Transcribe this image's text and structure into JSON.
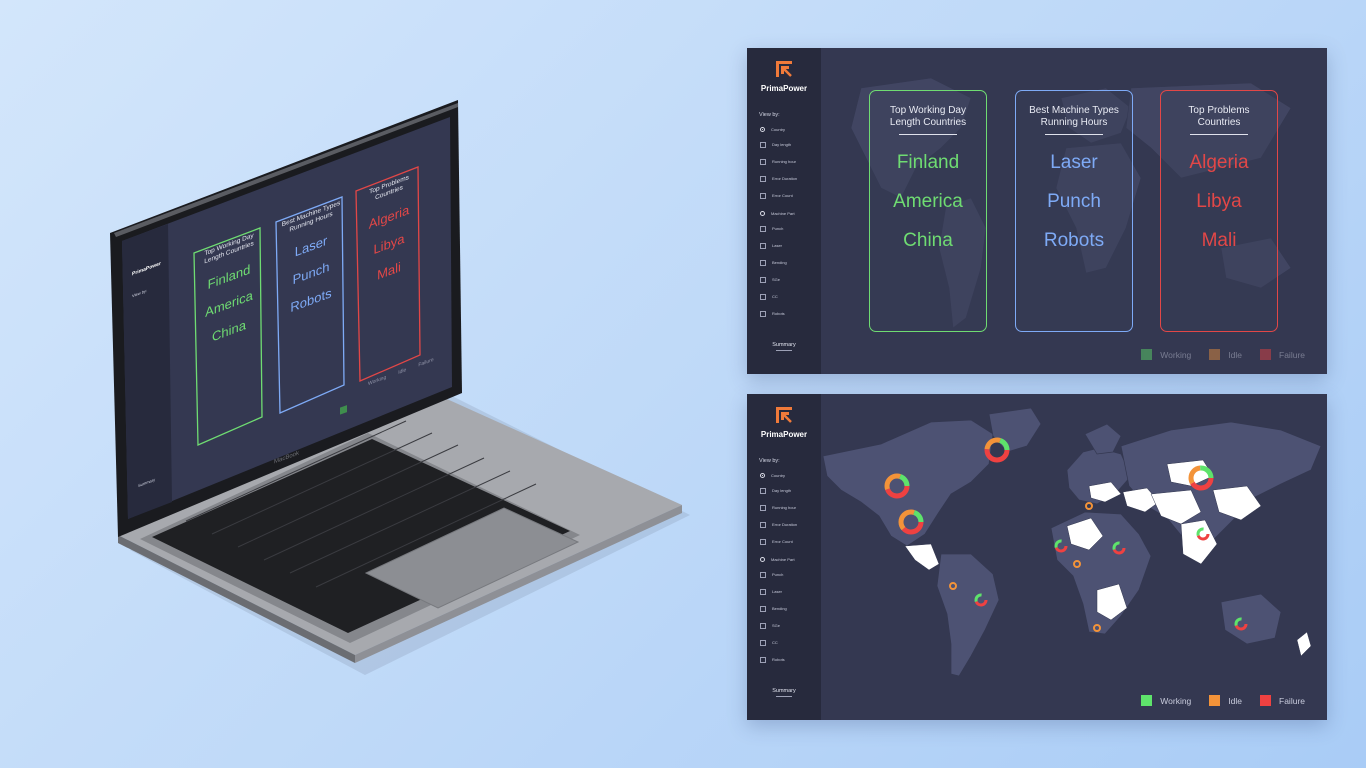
{
  "colors": {
    "background": "#c6ddf9",
    "panel_bg": "#343851",
    "sidebar_bg": "#272a3d",
    "working": "#5ee36b",
    "idle": "#f39339",
    "failure": "#ef4141",
    "card_green": "#6fdc72",
    "card_blue": "#7eaaf6",
    "card_red": "#e24747",
    "brand_orange": "#f07a3a"
  },
  "laptop": {
    "brand_label": "MacBook",
    "screen": {
      "brand": "PrimaPower",
      "view_by": "View by:",
      "summary": "Summary",
      "cards": [
        {
          "title_line1": "Top Working Day",
          "title_line2": "Length Countries",
          "items": [
            "Finland",
            "America",
            "China"
          ]
        },
        {
          "title_line1": "Best Machine Types",
          "title_line2": "Running Hours",
          "items": [
            "Laser",
            "Punch",
            "Robots"
          ]
        },
        {
          "title_line1": "Top Problems",
          "title_line2": "Countries",
          "items": [
            "Algeria",
            "Libya",
            "Mali"
          ]
        }
      ],
      "legend": [
        "Working",
        "Idle",
        "Failure"
      ]
    }
  },
  "panel1": {
    "brand": "PrimaPower",
    "view_by": "View by:",
    "options": [
      {
        "label": "Country",
        "type": "radio",
        "selected": true
      },
      {
        "label": "Day length",
        "type": "checkbox"
      },
      {
        "label": "Running hour",
        "type": "checkbox"
      },
      {
        "label": "Error Duration",
        "type": "checkbox"
      },
      {
        "label": "Error Count",
        "type": "checkbox"
      },
      {
        "label": "Machine Part",
        "type": "radio",
        "selected": false
      },
      {
        "label": "Punch",
        "type": "checkbox"
      },
      {
        "label": "Laser",
        "type": "checkbox"
      },
      {
        "label": "Bending",
        "type": "checkbox"
      },
      {
        "label": "SGe",
        "type": "checkbox"
      },
      {
        "label": "CC",
        "type": "checkbox"
      },
      {
        "label": "Robots",
        "type": "checkbox"
      }
    ],
    "summary": "Summary",
    "cards": [
      {
        "title_line1": "Top Working Day",
        "title_line2": "Length Countries",
        "items": [
          "Finland",
          "America",
          "China"
        ]
      },
      {
        "title_line1": "Best Machine Types",
        "title_line2": "Running Hours",
        "items": [
          "Laser",
          "Punch",
          "Robots"
        ]
      },
      {
        "title_line1": "Top Problems",
        "title_line2": "Countries",
        "items": [
          "Algeria",
          "Libya",
          "Mali"
        ]
      }
    ],
    "legend": [
      "Working",
      "Idle",
      "Failure"
    ]
  },
  "panel2": {
    "brand": "PrimaPower",
    "view_by": "View by:",
    "options": [
      {
        "label": "Country",
        "type": "radio",
        "selected": true
      },
      {
        "label": "Day length",
        "type": "checkbox"
      },
      {
        "label": "Running hour",
        "type": "checkbox"
      },
      {
        "label": "Error Duration",
        "type": "checkbox"
      },
      {
        "label": "Error Count",
        "type": "checkbox"
      },
      {
        "label": "Machine Part",
        "type": "radio",
        "selected": false
      },
      {
        "label": "Punch",
        "type": "checkbox"
      },
      {
        "label": "Laser",
        "type": "checkbox"
      },
      {
        "label": "Bending",
        "type": "checkbox"
      },
      {
        "label": "SGe",
        "type": "checkbox"
      },
      {
        "label": "CC",
        "type": "checkbox"
      },
      {
        "label": "Robots",
        "type": "checkbox"
      }
    ],
    "summary": "Summary",
    "legend": [
      "Working",
      "Idle",
      "Failure"
    ]
  }
}
